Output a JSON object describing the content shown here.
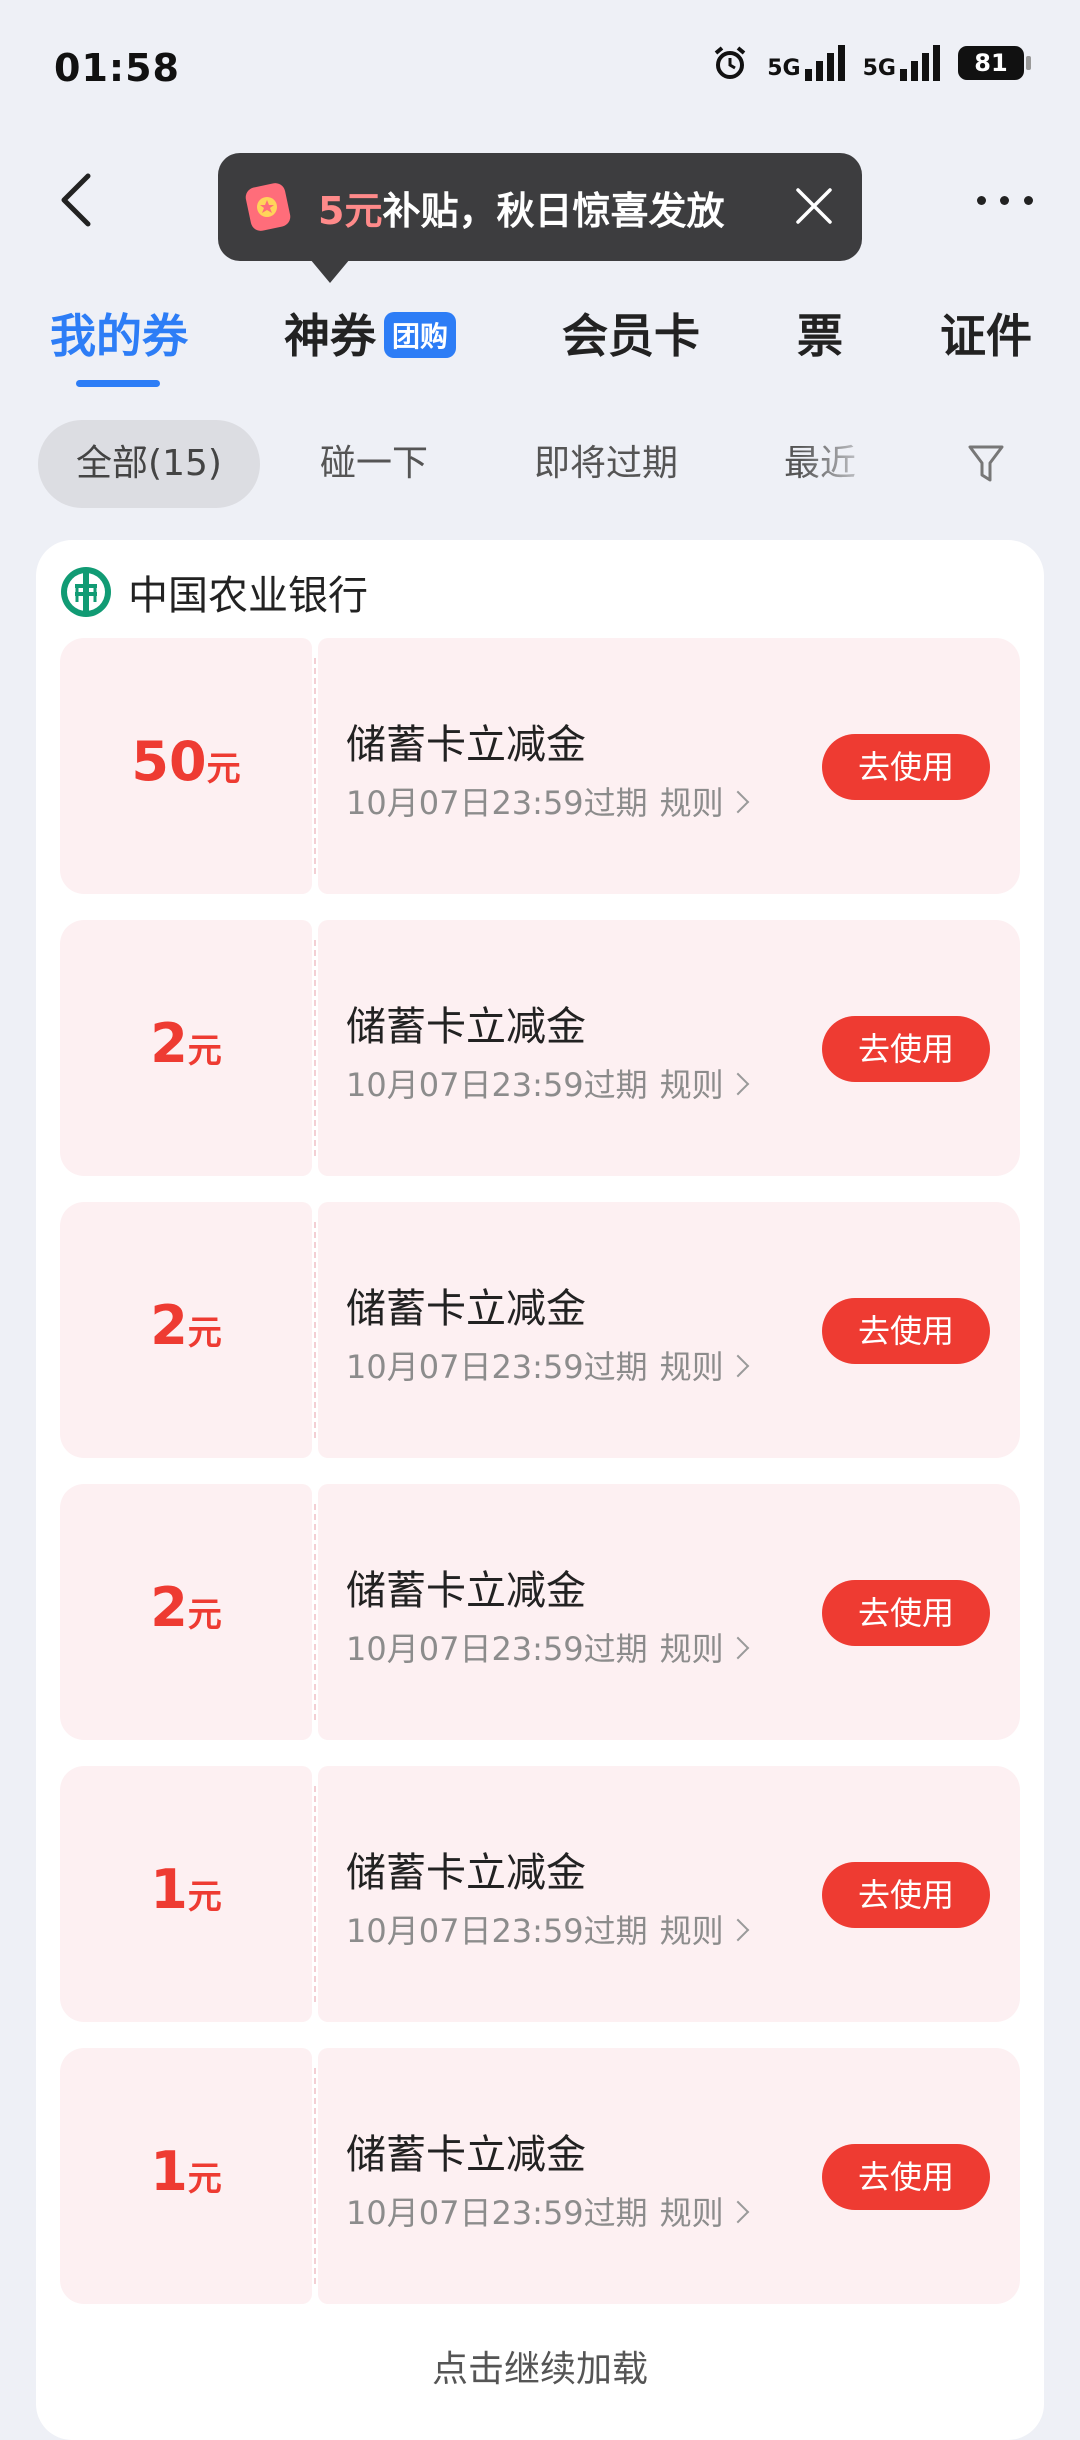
{
  "status_bar": {
    "time": "01:58",
    "network_1": "5G",
    "network_2": "5G",
    "battery": "81"
  },
  "promo": {
    "amount": "5元",
    "text": "补贴，秋日惊喜发放"
  },
  "tabs": [
    {
      "label": "我的券"
    },
    {
      "label": "神券",
      "badge": "团购"
    },
    {
      "label": "会员卡"
    },
    {
      "label": "票"
    },
    {
      "label": "证件"
    }
  ],
  "filters": [
    {
      "label": "全部(15)"
    },
    {
      "label": "碰一下"
    },
    {
      "label": "即将过期"
    },
    {
      "label": "最近"
    }
  ],
  "bank": {
    "name": "中国农业银行"
  },
  "coupons": [
    {
      "amount": "50",
      "unit": "元",
      "title": "储蓄卡立减金",
      "expire": "10月07日23:59过期",
      "rule": "规则",
      "button": "去使用"
    },
    {
      "amount": "2",
      "unit": "元",
      "title": "储蓄卡立减金",
      "expire": "10月07日23:59过期",
      "rule": "规则",
      "button": "去使用"
    },
    {
      "amount": "2",
      "unit": "元",
      "title": "储蓄卡立减金",
      "expire": "10月07日23:59过期",
      "rule": "规则",
      "button": "去使用"
    },
    {
      "amount": "2",
      "unit": "元",
      "title": "储蓄卡立减金",
      "expire": "10月07日23:59过期",
      "rule": "规则",
      "button": "去使用"
    },
    {
      "amount": "1",
      "unit": "元",
      "title": "储蓄卡立减金",
      "expire": "10月07日23:59过期",
      "rule": "规则",
      "button": "去使用"
    },
    {
      "amount": "1",
      "unit": "元",
      "title": "储蓄卡立减金",
      "expire": "10月07日23:59过期",
      "rule": "规则",
      "button": "去使用"
    }
  ],
  "load_more": "点击继续加载",
  "colors": {
    "accent": "#2d7df6",
    "coupon_red": "#ee3b32",
    "coupon_bg": "#fdf0f2"
  }
}
